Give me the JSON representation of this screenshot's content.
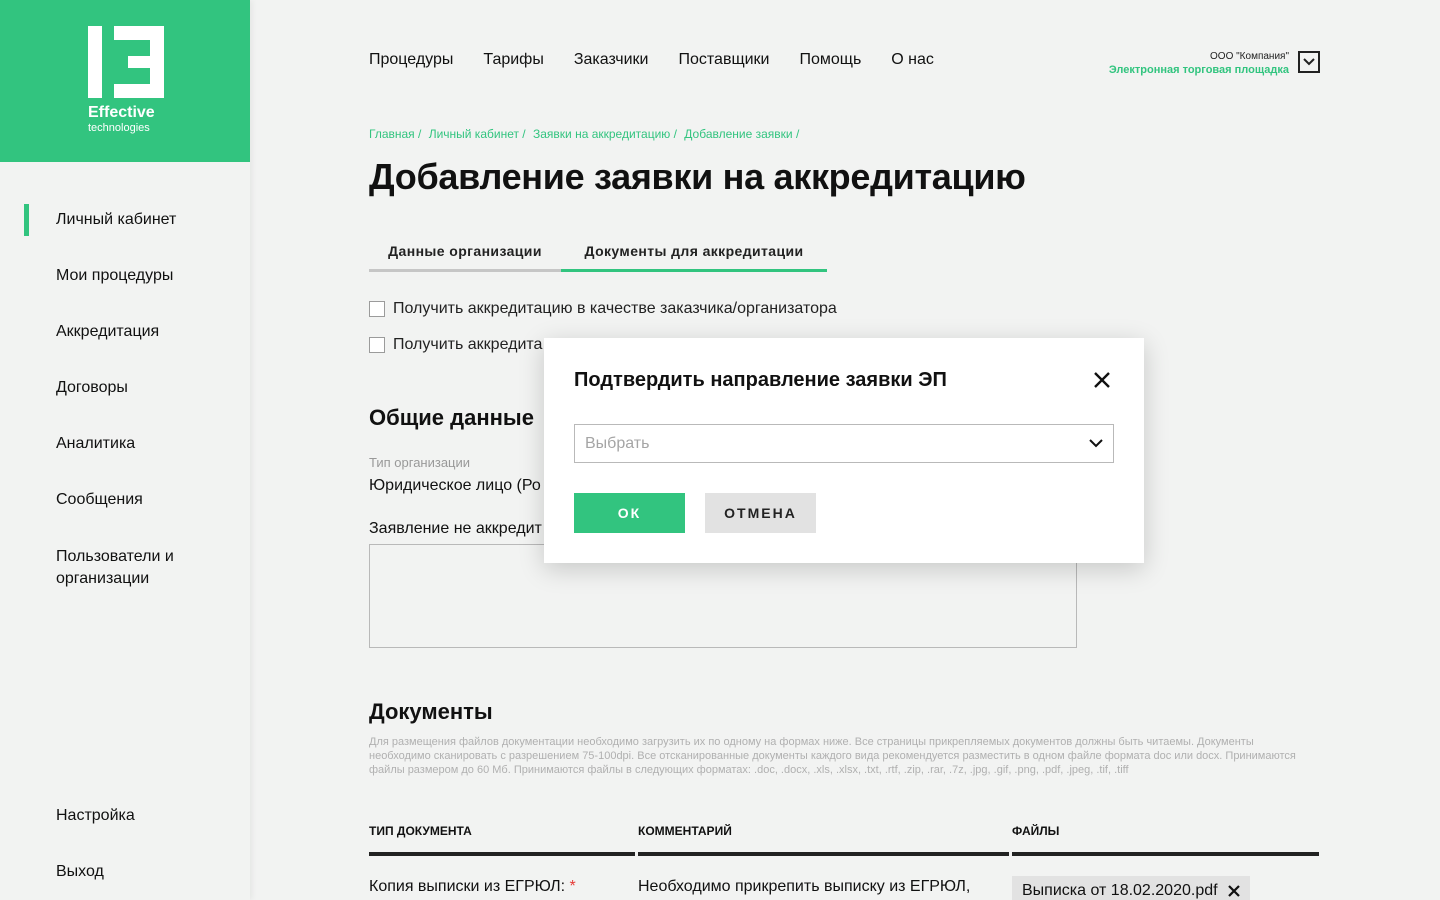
{
  "brand": {
    "name": "Effective",
    "tagline": "technologies",
    "accent": "#32c47f"
  },
  "sidebar": {
    "items": [
      {
        "label": "Личный кабинет",
        "active": true
      },
      {
        "label": "Мои процедуры"
      },
      {
        "label": "Аккредитация"
      },
      {
        "label": "Договоры"
      },
      {
        "label": "Аналитика"
      },
      {
        "label": "Сообщения"
      },
      {
        "label": "Пользователи и организации"
      }
    ],
    "bottom": [
      {
        "label": "Настройка"
      },
      {
        "label": "Выход"
      }
    ]
  },
  "topnav": {
    "items": [
      "Процедуры",
      "Тарифы",
      "Заказчики",
      "Поставщики",
      "Помощь",
      "О нас"
    ]
  },
  "company": {
    "name": "ООО \"Компания\"",
    "platform": "Электронная торговая площадка"
  },
  "breadcrumb": [
    "Главная /",
    "Личный кабинет /",
    "Заявки на аккредитацию /",
    "Добавление заявки /"
  ],
  "page": {
    "title": "Добавление заявки на аккредитацию",
    "tabs": [
      "Данные организации",
      "Документы для аккредитации"
    ],
    "checkbox_customer": "Получить аккредитацию в качестве заказчика/организатора",
    "checkbox_supplier": "Получить аккредита",
    "general_title": "Общие данные",
    "org_type_label": "Тип организации",
    "org_type_value": "Юридическое лицо (Ро",
    "statement_label": "Заявление не аккредит",
    "documents_title": "Документы",
    "documents_desc": "Для размещения файлов документации необходимо загрузить их по одному на формах ниже. Все страницы прикрепляемых документов должны быть читаемы. Документы необходимо сканировать с разрешением 75-100dpi. Все отсканированные документы каждого вида рекомендуется разместить в одном файле формата doc или docx. Принимаются файлы размером до 60 Мб. Принимаются файлы в следующих форматах: .doc, .docx, .xls, .xlsx, .txt, .rtf, .zip, .rar, .7z, .jpg, .gif, .png, .pdf, .jpeg, .tif, .tiff",
    "table": {
      "headers": [
        "ТИП ДОКУМЕНТА",
        "КОММЕНТАРИЙ",
        "ФАЙЛЫ"
      ],
      "row": {
        "type": "Копия выписки из ЕГРЮЛ:",
        "required_mark": "*",
        "comment": "Необходимо прикрепить выписку из ЕГРЮЛ,",
        "file": "Выписка от 18.02.2020.pdf"
      }
    }
  },
  "modal": {
    "title": "Подтвердить направление заявки ЭП",
    "select_placeholder": "Выбрать",
    "ok_label": "ОК",
    "cancel_label": "ОТМЕНА"
  }
}
